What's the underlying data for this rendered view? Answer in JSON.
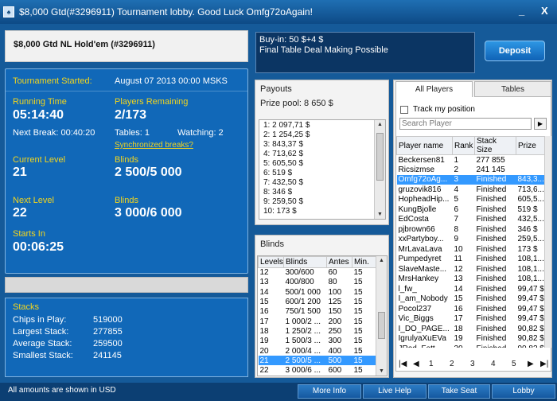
{
  "window": {
    "title": "$8,000 Gtd(#3296911) Tournament lobby. Good Luck Omfg72oAgain!",
    "minimize": "_",
    "close": "X"
  },
  "header": {
    "name": "$8,000 Gtd NL Hold'em (#3296911)"
  },
  "info": {
    "buyin": "Buy-in: 50 $+4 $",
    "note": "Final Table Deal Making Possible"
  },
  "deposit_label": "Deposit",
  "tournament": {
    "started_label": "Tournament Started:",
    "started_value": "August 07 2013  00:00 MSKS",
    "running_label": "Running Time",
    "running_value": "05:14:40",
    "remaining_label": "Players Remaining",
    "remaining_value": "2/173",
    "next_break": "Next Break: 00:40:20",
    "tables": "Tables: 1",
    "watching": "Watching: 2",
    "sync_link": "Synchronized breaks?",
    "current_level_label": "Current Level",
    "current_level_value": "21",
    "blinds_label": "Blinds",
    "blinds_value": "2 500/5 000",
    "next_level_label": "Next Level",
    "next_level_value": "22",
    "next_blinds_label": "Blinds",
    "next_blinds_value": "3 000/6 000",
    "starts_in_label": "Starts In",
    "starts_in_value": "00:06:25"
  },
  "stacks": {
    "title": "Stacks",
    "rows": [
      {
        "label": "Chips in Play:",
        "value": "519000"
      },
      {
        "label": "Largest Stack:",
        "value": "277855"
      },
      {
        "label": "Average Stack:",
        "value": "259500"
      },
      {
        "label": "Smallest Stack:",
        "value": "241145"
      }
    ]
  },
  "payouts": {
    "title": "Payouts",
    "prize_pool": "Prize pool: 8 650 $",
    "items": [
      "1: 2 097,71 $",
      "2: 1 254,25 $",
      "3: 843,37 $",
      "4: 713,62 $",
      "5: 605,50 $",
      "6: 519 $",
      "7: 432,50 $",
      "8: 346 $",
      "9: 259,50 $",
      "10: 173 $"
    ]
  },
  "blinds": {
    "title": "Blinds",
    "headers": [
      "Levels",
      "Blinds",
      "Antes",
      "Min."
    ],
    "rows": [
      [
        "12",
        "300/600",
        "60",
        "15"
      ],
      [
        "13",
        "400/800",
        "80",
        "15"
      ],
      [
        "14",
        "500/1 000",
        "100",
        "15"
      ],
      [
        "15",
        "600/1 200",
        "125",
        "15"
      ],
      [
        "16",
        "750/1 500",
        "150",
        "15"
      ],
      [
        "17",
        "1 000/2 ...",
        "200",
        "15"
      ],
      [
        "18",
        "1 250/2 ...",
        "250",
        "15"
      ],
      [
        "19",
        "1 500/3 ...",
        "300",
        "15"
      ],
      [
        "20",
        "2 000/4 ...",
        "400",
        "15"
      ],
      [
        "21",
        "2 500/5 ...",
        "500",
        "15"
      ],
      [
        "22",
        "3 000/6 ...",
        "600",
        "15"
      ]
    ],
    "selected": 9
  },
  "players": {
    "tab_all": "All Players",
    "tab_tables": "Tables",
    "track_label": "Track my position",
    "search_placeholder": "Search Player",
    "headers": [
      "Player name",
      "Rank",
      "Stack Size",
      "Prize"
    ],
    "rows": [
      [
        "Beckersen81",
        "1",
        "277 855",
        ""
      ],
      [
        "Ricsizmse",
        "2",
        "241 145",
        ""
      ],
      [
        "Omfg72oAg...",
        "3",
        "Finished",
        "843,3..."
      ],
      [
        "gruzovik816",
        "4",
        "Finished",
        "713,6..."
      ],
      [
        "HopheadHip...",
        "5",
        "Finished",
        "605,5..."
      ],
      [
        "KungBjolle",
        "6",
        "Finished",
        "519 $"
      ],
      [
        "EdCosta",
        "7",
        "Finished",
        "432,5..."
      ],
      [
        "pjbrown66",
        "8",
        "Finished",
        "346 $"
      ],
      [
        "xxPartyboy...",
        "9",
        "Finished",
        "259,5..."
      ],
      [
        "MrLavaLava",
        "10",
        "Finished",
        "173 $"
      ],
      [
        "Pumpedyret",
        "11",
        "Finished",
        "108,1..."
      ],
      [
        "SlaveMaste...",
        "12",
        "Finished",
        "108,1..."
      ],
      [
        "MrsHankey",
        "13",
        "Finished",
        "108,1..."
      ],
      [
        "l_fw_",
        "14",
        "Finished",
        "99,47 $"
      ],
      [
        "I_am_Nobody",
        "15",
        "Finished",
        "99,47 $"
      ],
      [
        "Pocol237",
        "16",
        "Finished",
        "99,47 $"
      ],
      [
        "Vic_Biggs",
        "17",
        "Finished",
        "99,47 $"
      ],
      [
        "I_DO_PAGE...",
        "18",
        "Finished",
        "90,82 $"
      ],
      [
        "IgrulyaXuEVa",
        "19",
        "Finished",
        "90,82 $"
      ],
      [
        "JRod_Fett",
        "20",
        "Finished",
        "90,82 $"
      ]
    ],
    "selected": 2,
    "pages": [
      "1",
      "2",
      "3",
      "4",
      "5"
    ]
  },
  "footer": {
    "message": "All amounts are shown in USD",
    "buttons": [
      "More Info",
      "Live Help",
      "Take Seat",
      "Lobby"
    ]
  },
  "colors": {
    "accent_yellow": "#f2d51e",
    "panel_blue": "#1168b8",
    "selection": "#3399ff"
  }
}
